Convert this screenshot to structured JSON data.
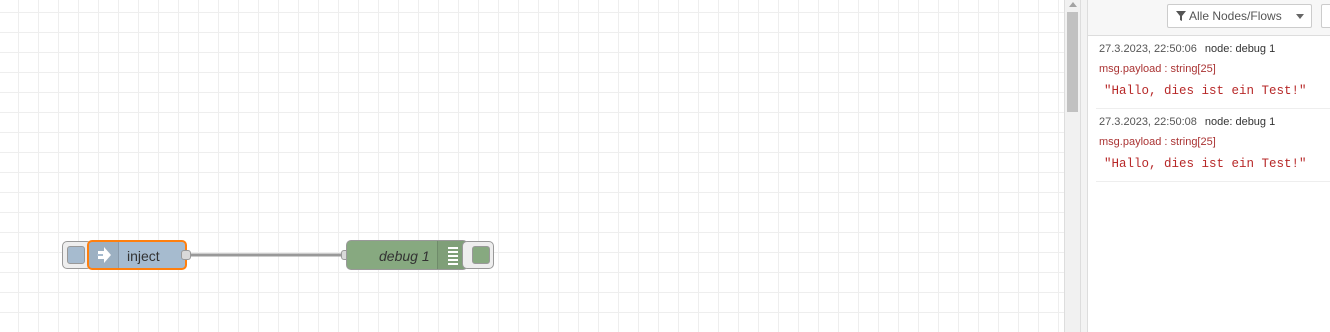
{
  "flow": {
    "inject_node": {
      "label": "inject",
      "color": "#a6bbcf",
      "selected_border": "#ff7f0e",
      "icon": "inject-arrow-icon"
    },
    "debug_node": {
      "label": "debug 1",
      "color": "#87a980",
      "icon": "debug-list-icon"
    }
  },
  "sidebar": {
    "filter_label": "Alle Nodes/Flows",
    "messages": [
      {
        "timestamp": "27.3.2023, 22:50:06",
        "node": "node: debug 1",
        "topic": "msg.payload : string[25]",
        "payload": "\"Hallo, dies ist ein Test!\""
      },
      {
        "timestamp": "27.3.2023, 22:50:08",
        "node": "node: debug 1",
        "topic": "msg.payload : string[25]",
        "payload": "\"Hallo, dies ist ein Test!\""
      }
    ]
  }
}
